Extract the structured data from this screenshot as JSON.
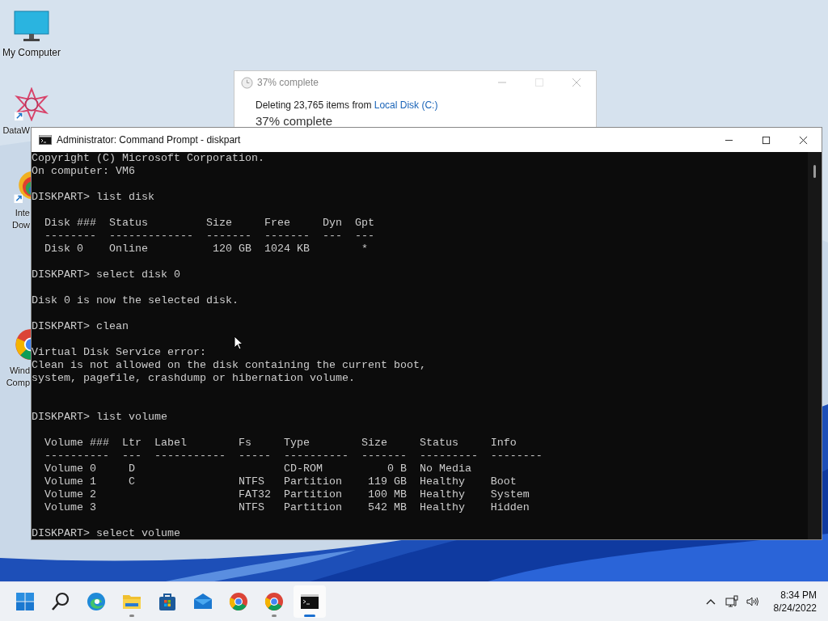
{
  "desktop_icons": [
    {
      "kind": "monitor",
      "lines": [
        "My Computer"
      ]
    },
    {
      "kind": "star",
      "lines": [
        "DataW"
      ]
    },
    {
      "kind": "rainbow",
      "lines": [
        "Inte",
        "Dow"
      ]
    },
    {
      "kind": "chrome",
      "lines": [
        "Wind",
        "Comp"
      ]
    }
  ],
  "progress_dialog": {
    "title": "37% complete",
    "message": "Deleting 23,765 items from ",
    "source_link": "Local Disk (C:)",
    "status": "37% complete"
  },
  "console_window": {
    "title": "Administrator: Command Prompt - diskpart",
    "lines": [
      {
        "kind": "text",
        "text": "Copyright (C) Microsoft Corporation."
      },
      {
        "kind": "text",
        "text": "On computer: VM6"
      },
      {
        "kind": "blank"
      },
      {
        "kind": "text",
        "text": "DISKPART> list disk"
      },
      {
        "kind": "blank"
      },
      {
        "kind": "text",
        "text": "  Disk ###  Status         Size     Free     Dyn  Gpt"
      },
      {
        "kind": "text",
        "text": "  --------  -------------  -------  -------  ---  ---"
      },
      {
        "kind": "text",
        "text": "  Disk 0    Online          120 GB  1024 KB        *"
      },
      {
        "kind": "blank"
      },
      {
        "kind": "text",
        "text": "DISKPART> select disk 0"
      },
      {
        "kind": "blank"
      },
      {
        "kind": "text",
        "text": "Disk 0 is now the selected disk."
      },
      {
        "kind": "blank"
      },
      {
        "kind": "text",
        "text": "DISKPART> clean"
      },
      {
        "kind": "blank"
      },
      {
        "kind": "text",
        "text": "Virtual Disk Service error:"
      },
      {
        "kind": "text",
        "text": "Clean is not allowed on the disk containing the current boot,"
      },
      {
        "kind": "text",
        "text": "system, pagefile, crashdump or hibernation volume."
      },
      {
        "kind": "blank"
      },
      {
        "kind": "blank"
      },
      {
        "kind": "text",
        "text": "DISKPART> list volume"
      },
      {
        "kind": "blank"
      },
      {
        "kind": "text",
        "text": "  Volume ###  Ltr  Label        Fs     Type        Size     Status     Info"
      },
      {
        "kind": "text",
        "text": "  ----------  ---  -----------  -----  ----------  -------  ---------  --------"
      },
      {
        "kind": "text",
        "text": "  Volume 0     D                       CD-ROM          0 B  No Media"
      },
      {
        "kind": "text",
        "text": "  Volume 1     C                NTFS   Partition    119 GB  Healthy    Boot"
      },
      {
        "kind": "text",
        "text": "  Volume 2                      FAT32  Partition    100 MB  Healthy    System"
      },
      {
        "kind": "text",
        "text": "  Volume 3                      NTFS   Partition    542 MB  Healthy    Hidden"
      },
      {
        "kind": "blank"
      },
      {
        "kind": "text",
        "text": "DISKPART> select volume"
      }
    ]
  },
  "taskbar": {
    "apps": [
      {
        "kind": "start",
        "running": false,
        "selected": false
      },
      {
        "kind": "search",
        "running": false,
        "selected": false
      },
      {
        "kind": "edge",
        "running": false,
        "selected": false
      },
      {
        "kind": "folder",
        "running": true,
        "selected": false
      },
      {
        "kind": "store",
        "running": false,
        "selected": false
      },
      {
        "kind": "mail",
        "running": false,
        "selected": false
      },
      {
        "kind": "chrome",
        "running": false,
        "selected": false
      },
      {
        "kind": "chrome",
        "running": true,
        "selected": false
      },
      {
        "kind": "terminal",
        "running": true,
        "selected": true
      }
    ],
    "time": "8:34 PM",
    "date": "8/24/2022"
  }
}
